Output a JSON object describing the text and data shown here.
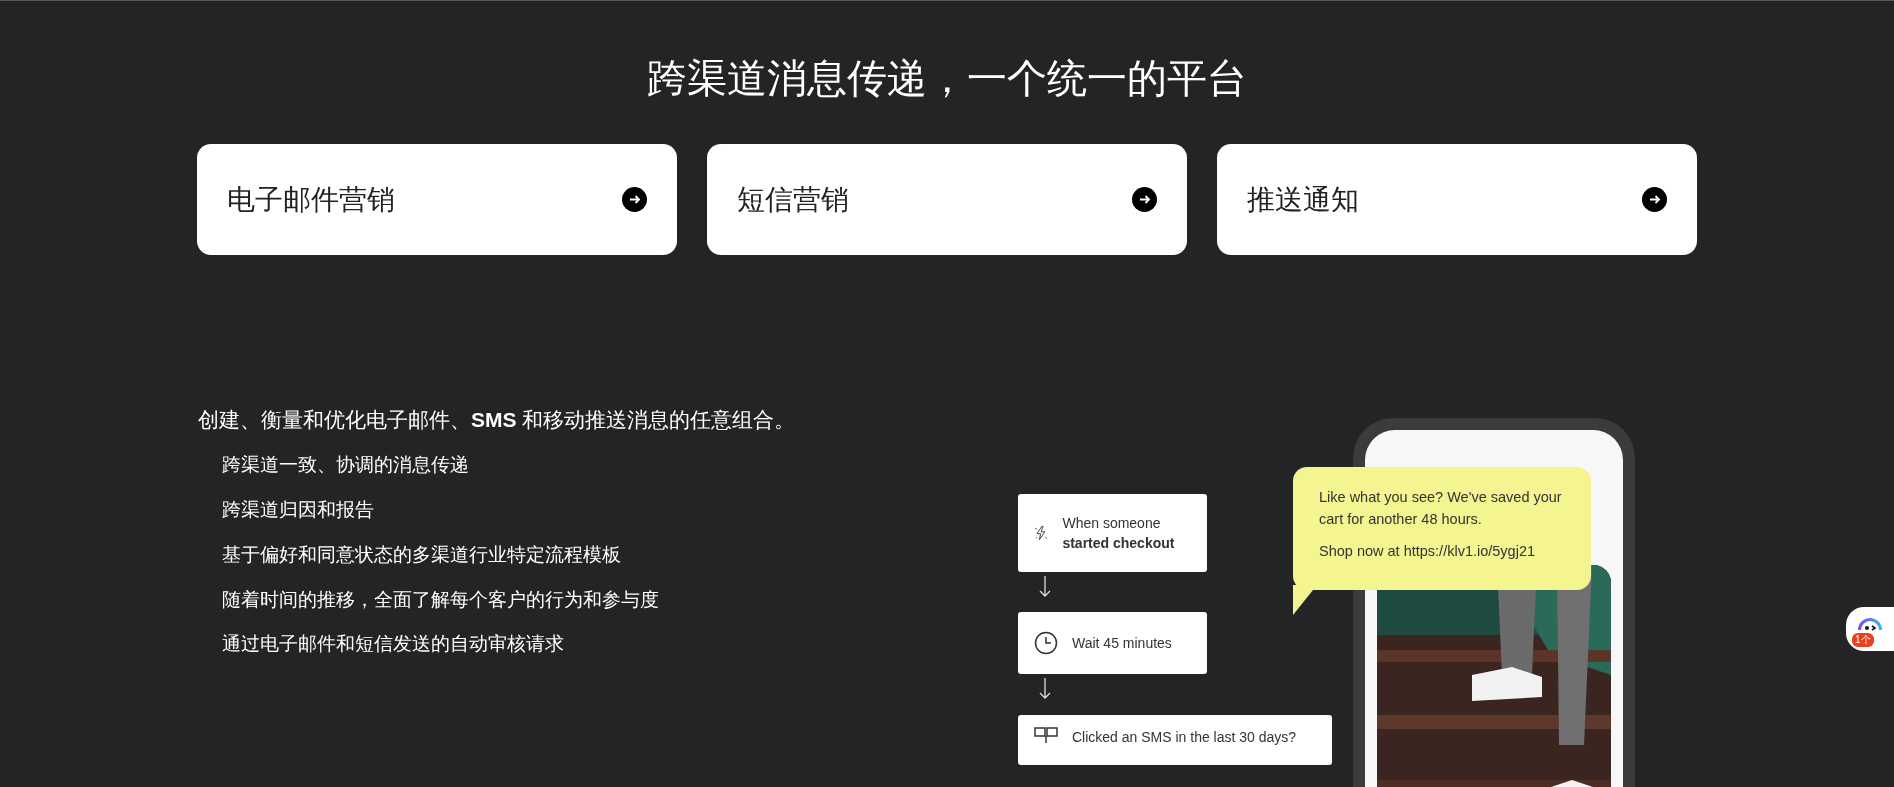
{
  "heading": "跨渠道消息传递，一个统一的平台",
  "channel_cards": [
    {
      "label": "电子邮件营销"
    },
    {
      "label": "短信营销"
    },
    {
      "label": "推送通知"
    }
  ],
  "intro": "创建、衡量和优化电子邮件、**SMS** 和移动推送消息的任意组合。",
  "features": [
    "跨渠道一致、协调的消息传递",
    "跨渠道归因和报告",
    "基于偏好和同意状态的多渠道行业特定流程模板",
    "随着时间的推移，全面了解每个客户的行为和参与度",
    "通过电子邮件和短信发送的自动审核请求"
  ],
  "flow_steps": [
    {
      "kind": "trigger",
      "text": "When someone **started checkout**"
    },
    {
      "kind": "delay",
      "text": "Wait 45 minutes"
    },
    {
      "kind": "split",
      "text": "Clicked an SMS in the last 30 days?"
    }
  ],
  "sms_bubble": {
    "lines": [
      "Like what you see? We've saved your cart for another 48 hours.",
      "Shop now at https://klv1.io/5ygj21"
    ]
  },
  "support_widget": {
    "badge": "1个"
  }
}
